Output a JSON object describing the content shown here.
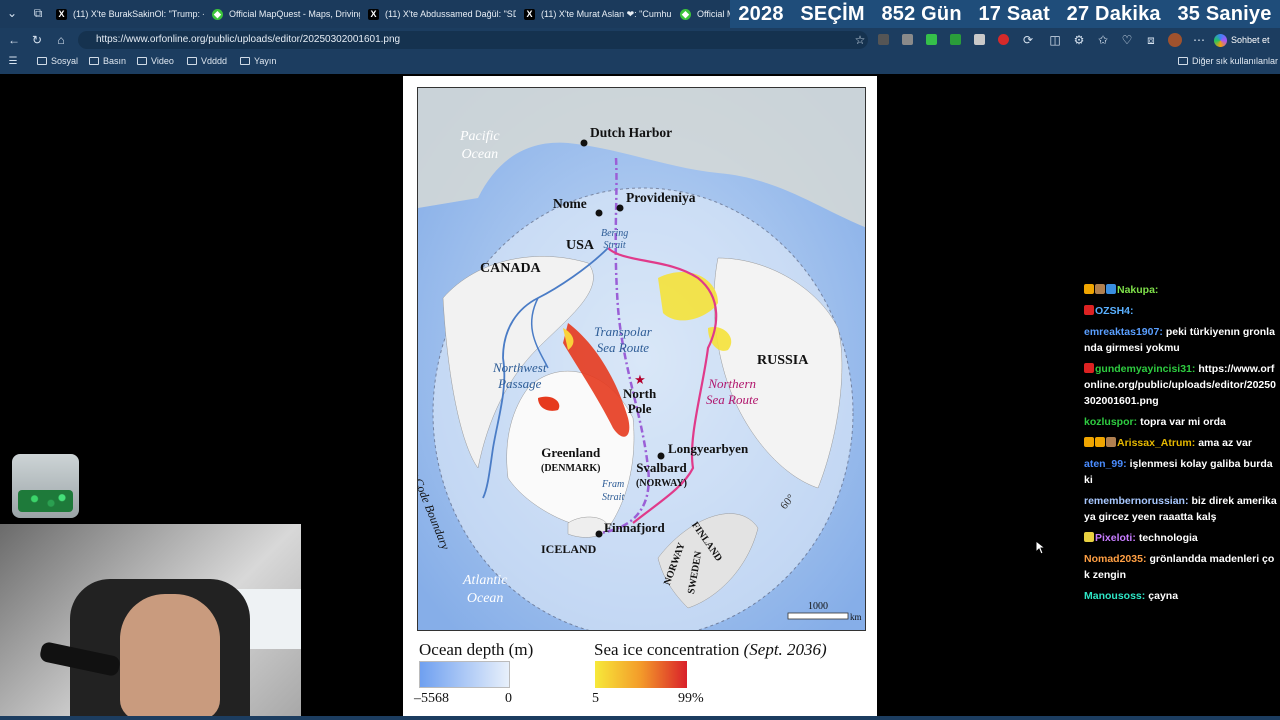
{
  "tabs": [
    {
      "icon": "x-icon",
      "label": "(11) X'te BurakSakinOl: \"Trump: -"
    },
    {
      "icon": "mapquest-icon",
      "label": "Official MapQuest - Maps, Driving"
    },
    {
      "icon": "x-icon",
      "label": "(11) X'te Abdussamed Dağül: \"SD"
    },
    {
      "icon": "x-icon",
      "label": "(11) X'te Murat Aslan ❤: \"Cumhu"
    },
    {
      "icon": "mapquest-icon",
      "label": "Official Ma"
    }
  ],
  "banner": {
    "year": "2028",
    "title": "SEÇİM",
    "days": "852 Gün",
    "hours": "17 Saat",
    "minutes": "27 Dakika",
    "seconds": "35 Saniye"
  },
  "address": {
    "url": "https://www.orfonline.org/public/uploads/editor/20250302001601.png"
  },
  "profile": {
    "label": "Sohbet et"
  },
  "bookmarks": [
    "Sosyal",
    "Basın",
    "Video",
    "Vdddd",
    "Yayın"
  ],
  "bookmarks_other": "Diğer sık kullanılanlar",
  "map": {
    "labels": {
      "pacific": "Pacific Ocean",
      "pacific_1": "Pacific",
      "pacific_2": "Ocean",
      "dutch_harbor": "Dutch Harbor",
      "nome": "Nome",
      "provideniya": "Provideniya",
      "usa": "USA",
      "bering_1": "Bering",
      "bering_2": "Strait",
      "canada": "CANADA",
      "transpolar_1": "Transpolar",
      "transpolar_2": "Sea Route",
      "russia": "RUSSIA",
      "northwest_1": "Northwest",
      "northwest_2": "Passage",
      "north_pole_1": "North",
      "north_pole_2": "Pole",
      "northern_1": "Northern",
      "northern_2": "Sea Route",
      "polar_code": "Polar Code Boundary",
      "greenland": "Greenland",
      "denmark": "(DENMARK)",
      "longyearbyen": "Longyearbyen",
      "svalbard": "Svalbard",
      "norway_paren": "(NORWAY)",
      "fram_1": "Fram",
      "fram_2": "Strait",
      "finnafjord": "Finnafjord",
      "finland": "FINLAND",
      "norway": "NORWAY",
      "sweden": "SWEDEN",
      "iceland": "ICELAND",
      "atlantic_1": "Atlantic",
      "atlantic_2": "Ocean",
      "deg60": "60°",
      "scale_value": "1000",
      "scale_unit": "km"
    }
  },
  "legend": {
    "depth_title": "Ocean depth (m)",
    "depth_min": "–5568",
    "depth_max": "0",
    "ice_title": "Sea ice concentration",
    "ice_date": "(Sept. 2036)",
    "ice_min": "5",
    "ice_max": "99%"
  },
  "chat": [
    {
      "user": "Nakupa:",
      "color": "#7fe04a",
      "text": "",
      "badges": [
        "#f0a500",
        "#b08050",
        "#3a8ee0"
      ]
    },
    {
      "user": "OZSH4:",
      "color": "#5ab0ff",
      "text": "",
      "badges": [
        "#d22"
      ]
    },
    {
      "user": "emreaktas1907:",
      "color": "#5a9fff",
      "text": "peki türkiyenın gronlanda girmesi yokmu",
      "badges": []
    },
    {
      "user": "gundemyayincisi31:",
      "color": "#2ecc40",
      "text": "https://www.orfonline.org/public/uploads/editor/20250302001601.png",
      "badges": [
        "#d22"
      ]
    },
    {
      "user": "kozluspor:",
      "color": "#2ecc40",
      "text": "topra var mi orda",
      "badges": []
    },
    {
      "user": "Arissax_Atrum:",
      "color": "#e6b800",
      "text": "ama az var",
      "badges": [
        "#f0a500",
        "#f0a500",
        "#b08050"
      ]
    },
    {
      "user": "aten_99:",
      "color": "#4a8cff",
      "text": "işlenmesi kolay galiba burdaki",
      "badges": []
    },
    {
      "user": "remembernorussian:",
      "color": "#a8c8ff",
      "text": "biz direk amerikaya gircez yeen raaatta kalş",
      "badges": []
    },
    {
      "user": "Pixeloti:",
      "color": "#c77dff",
      "text": "technologia",
      "badges": [
        "#e8d040"
      ]
    },
    {
      "user": "Nomad2035:",
      "color": "#ff9f43",
      "text": "grönlandda madenleri çok zengin",
      "badges": []
    },
    {
      "user": "Manousoss:",
      "color": "#2ee6c6",
      "text": "çayna",
      "badges": []
    }
  ],
  "colors": {
    "tabbar": "#1b3a5c",
    "banner": "#1f4d7a",
    "toolbar": "#1c3d60",
    "ice_low": "#f7e93a",
    "ice_high": "#d9202a",
    "depth_low": "#6fa0f0"
  }
}
